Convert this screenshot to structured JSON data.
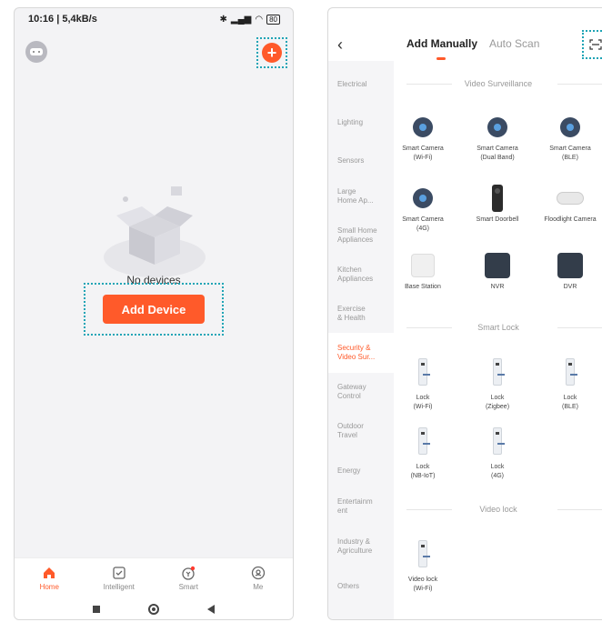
{
  "left": {
    "status": {
      "time": "10:16 | 5,4kB/s",
      "battery": "80"
    },
    "empty_text": "No devices",
    "add_device_label": "Add Device",
    "tabs": [
      {
        "label": "Home",
        "icon": "home-icon"
      },
      {
        "label": "Intelligent",
        "icon": "checkbox-icon"
      },
      {
        "label": "Smart",
        "icon": "smart-icon"
      },
      {
        "label": "Me",
        "icon": "profile-icon"
      }
    ]
  },
  "right": {
    "tabs": {
      "active": "Add Manually",
      "inactive": "Auto Scan"
    },
    "categories": [
      "Electrical",
      "Lighting",
      "Sensors",
      "Large\nHome Ap...",
      "Small Home\nAppliances",
      "Kitchen\nAppliances",
      "Exercise\n& Health",
      "Security &\nVideo Sur...",
      "Gateway\nControl",
      "Outdoor\nTravel",
      "Energy",
      "Entertainm\nent",
      "Industry &\nAgriculture",
      "Others"
    ],
    "sections": {
      "video": "Video Surveillance",
      "lock": "Smart Lock",
      "videolock": "Video lock"
    },
    "devices": {
      "cam_wifi": "Smart Camera\n(Wi-Fi)",
      "cam_dual": "Smart Camera\n(Dual Band)",
      "cam_ble": "Smart Camera\n(BLE)",
      "cam_4g": "Smart Camera\n(4G)",
      "doorbell": "Smart Doorbell",
      "floodlight": "Floodlight Camera",
      "base": "Base Station",
      "nvr": "NVR",
      "dvr": "DVR",
      "lock_wifi": "Lock\n(Wi-Fi)",
      "lock_zigbee": "Lock\n(Zigbee)",
      "lock_ble": "Lock\n(BLE)",
      "lock_nbiot": "Lock\n(NB-IoT)",
      "lock_4g": "Lock\n(4G)",
      "videolock_wifi": "Video lock\n(Wi-Fi)"
    }
  }
}
